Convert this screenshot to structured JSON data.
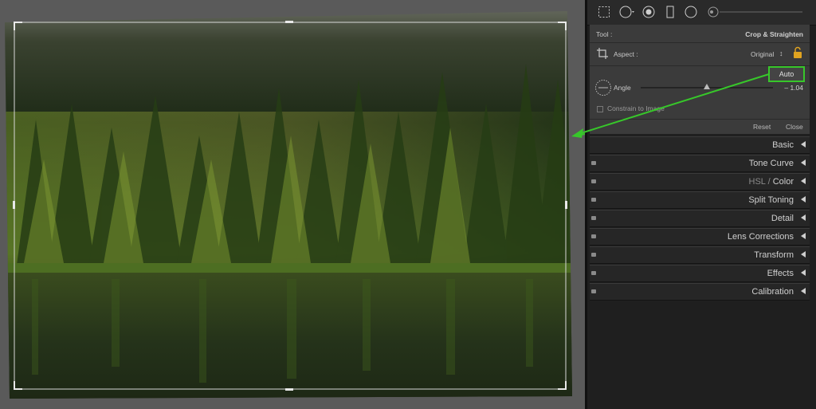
{
  "toolbar": {
    "icons": [
      "crop-overlay-icon",
      "spot-removal-icon",
      "red-eye-icon",
      "graduated-filter-icon",
      "radial-filter-icon",
      "adjustment-brush-icon"
    ]
  },
  "crop": {
    "tool_label": "Tool :",
    "tool_value": "Crop & Straighten",
    "aspect_label": "Aspect :",
    "aspect_value": "Original",
    "aspect_arrows": "↕",
    "auto_label": "Auto",
    "angle_label": "Angle",
    "angle_value": "– 1.04",
    "angle_slider": 0.5,
    "constrain_label": "Constrain to Image",
    "reset_label": "Reset",
    "close_label": "Close"
  },
  "sections": [
    {
      "label": "Basic"
    },
    {
      "label": "Tone Curve"
    },
    {
      "label_dim": "HSL",
      "sep": " / ",
      "label": "Color"
    },
    {
      "label": "Split Toning"
    },
    {
      "label": "Detail"
    },
    {
      "label": "Lens Corrections"
    },
    {
      "label": "Transform"
    },
    {
      "label": "Effects"
    },
    {
      "label": "Calibration"
    }
  ],
  "colors": {
    "highlight": "#37c72a",
    "panel_bg": "#1f1f1f",
    "crop_bg": "#3b3b3b"
  }
}
